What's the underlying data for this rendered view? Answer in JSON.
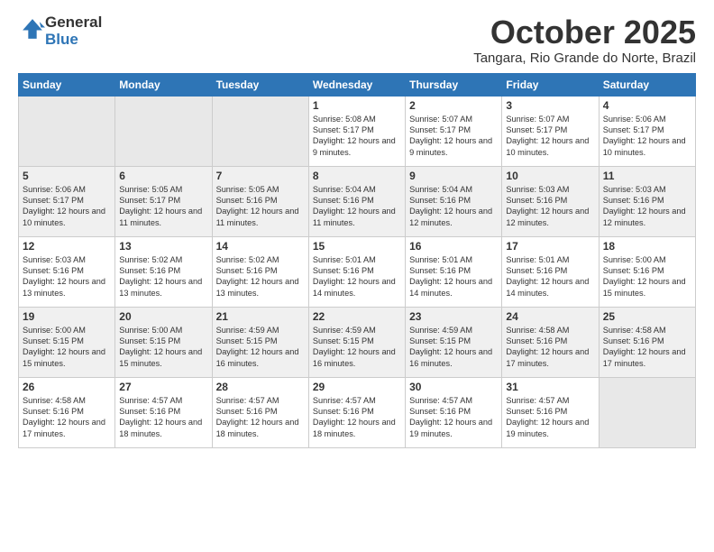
{
  "header": {
    "logo_general": "General",
    "logo_blue": "Blue",
    "month": "October 2025",
    "location": "Tangara, Rio Grande do Norte, Brazil"
  },
  "days_of_week": [
    "Sunday",
    "Monday",
    "Tuesday",
    "Wednesday",
    "Thursday",
    "Friday",
    "Saturday"
  ],
  "weeks": [
    [
      {
        "day": "",
        "empty": true
      },
      {
        "day": "",
        "empty": true
      },
      {
        "day": "",
        "empty": true
      },
      {
        "day": "1",
        "sunrise": "5:08 AM",
        "sunset": "5:17 PM",
        "daylight": "12 hours and 9 minutes."
      },
      {
        "day": "2",
        "sunrise": "5:07 AM",
        "sunset": "5:17 PM",
        "daylight": "12 hours and 9 minutes."
      },
      {
        "day": "3",
        "sunrise": "5:07 AM",
        "sunset": "5:17 PM",
        "daylight": "12 hours and 10 minutes."
      },
      {
        "day": "4",
        "sunrise": "5:06 AM",
        "sunset": "5:17 PM",
        "daylight": "12 hours and 10 minutes."
      }
    ],
    [
      {
        "day": "5",
        "sunrise": "5:06 AM",
        "sunset": "5:17 PM",
        "daylight": "12 hours and 10 minutes."
      },
      {
        "day": "6",
        "sunrise": "5:05 AM",
        "sunset": "5:17 PM",
        "daylight": "12 hours and 11 minutes."
      },
      {
        "day": "7",
        "sunrise": "5:05 AM",
        "sunset": "5:16 PM",
        "daylight": "12 hours and 11 minutes."
      },
      {
        "day": "8",
        "sunrise": "5:04 AM",
        "sunset": "5:16 PM",
        "daylight": "12 hours and 11 minutes."
      },
      {
        "day": "9",
        "sunrise": "5:04 AM",
        "sunset": "5:16 PM",
        "daylight": "12 hours and 12 minutes."
      },
      {
        "day": "10",
        "sunrise": "5:03 AM",
        "sunset": "5:16 PM",
        "daylight": "12 hours and 12 minutes."
      },
      {
        "day": "11",
        "sunrise": "5:03 AM",
        "sunset": "5:16 PM",
        "daylight": "12 hours and 12 minutes."
      }
    ],
    [
      {
        "day": "12",
        "sunrise": "5:03 AM",
        "sunset": "5:16 PM",
        "daylight": "12 hours and 13 minutes."
      },
      {
        "day": "13",
        "sunrise": "5:02 AM",
        "sunset": "5:16 PM",
        "daylight": "12 hours and 13 minutes."
      },
      {
        "day": "14",
        "sunrise": "5:02 AM",
        "sunset": "5:16 PM",
        "daylight": "12 hours and 13 minutes."
      },
      {
        "day": "15",
        "sunrise": "5:01 AM",
        "sunset": "5:16 PM",
        "daylight": "12 hours and 14 minutes."
      },
      {
        "day": "16",
        "sunrise": "5:01 AM",
        "sunset": "5:16 PM",
        "daylight": "12 hours and 14 minutes."
      },
      {
        "day": "17",
        "sunrise": "5:01 AM",
        "sunset": "5:16 PM",
        "daylight": "12 hours and 14 minutes."
      },
      {
        "day": "18",
        "sunrise": "5:00 AM",
        "sunset": "5:16 PM",
        "daylight": "12 hours and 15 minutes."
      }
    ],
    [
      {
        "day": "19",
        "sunrise": "5:00 AM",
        "sunset": "5:15 PM",
        "daylight": "12 hours and 15 minutes."
      },
      {
        "day": "20",
        "sunrise": "5:00 AM",
        "sunset": "5:15 PM",
        "daylight": "12 hours and 15 minutes."
      },
      {
        "day": "21",
        "sunrise": "4:59 AM",
        "sunset": "5:15 PM",
        "daylight": "12 hours and 16 minutes."
      },
      {
        "day": "22",
        "sunrise": "4:59 AM",
        "sunset": "5:15 PM",
        "daylight": "12 hours and 16 minutes."
      },
      {
        "day": "23",
        "sunrise": "4:59 AM",
        "sunset": "5:15 PM",
        "daylight": "12 hours and 16 minutes."
      },
      {
        "day": "24",
        "sunrise": "4:58 AM",
        "sunset": "5:16 PM",
        "daylight": "12 hours and 17 minutes."
      },
      {
        "day": "25",
        "sunrise": "4:58 AM",
        "sunset": "5:16 PM",
        "daylight": "12 hours and 17 minutes."
      }
    ],
    [
      {
        "day": "26",
        "sunrise": "4:58 AM",
        "sunset": "5:16 PM",
        "daylight": "12 hours and 17 minutes."
      },
      {
        "day": "27",
        "sunrise": "4:57 AM",
        "sunset": "5:16 PM",
        "daylight": "12 hours and 18 minutes."
      },
      {
        "day": "28",
        "sunrise": "4:57 AM",
        "sunset": "5:16 PM",
        "daylight": "12 hours and 18 minutes."
      },
      {
        "day": "29",
        "sunrise": "4:57 AM",
        "sunset": "5:16 PM",
        "daylight": "12 hours and 18 minutes."
      },
      {
        "day": "30",
        "sunrise": "4:57 AM",
        "sunset": "5:16 PM",
        "daylight": "12 hours and 19 minutes."
      },
      {
        "day": "31",
        "sunrise": "4:57 AM",
        "sunset": "5:16 PM",
        "daylight": "12 hours and 19 minutes."
      },
      {
        "day": "",
        "empty": true
      }
    ]
  ]
}
